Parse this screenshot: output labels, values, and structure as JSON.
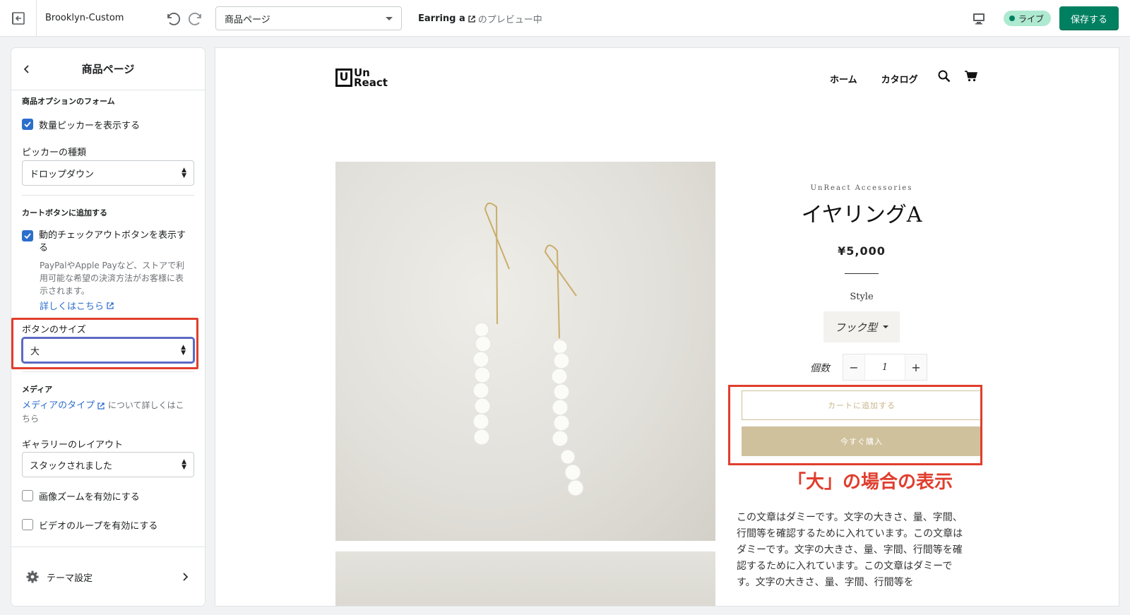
{
  "topbar": {
    "theme_name": "Brooklyn-Custom",
    "page_select": "商品ページ",
    "preview_product": "Earring a",
    "preview_suffix": "のプレビュー中",
    "live_label": "ライブ",
    "save_label": "保存する"
  },
  "sidebar": {
    "title": "商品ページ",
    "section_form": "商品オプションのフォーム",
    "show_qty_picker": "数量ピッカーを表示する",
    "picker_type_label": "ピッカーの種類",
    "picker_type_value": "ドロップダウン",
    "section_cart": "カートボタンに追加する",
    "dynamic_checkout": "動的チェックアウトボタンを表示する",
    "dynamic_help": "PayPalやApple Payなど、ストアで利用可能な希望の決済方法がお客様に表示されます。",
    "learn_more": "詳しくはこちら",
    "button_size_label": "ボタンのサイズ",
    "button_size_value": "大",
    "section_media": "メディア",
    "media_type_link": "メディアのタイプ",
    "media_type_suffix": "について詳しくはこちら",
    "gallery_layout_label": "ギャラリーのレイアウト",
    "gallery_layout_value": "スタックされました",
    "image_zoom": "画像ズームを有効にする",
    "video_loop": "ビデオのループを有効にする",
    "theme_settings": "テーマ設定"
  },
  "store": {
    "logo_box": "U",
    "logo_top": "Un",
    "logo_bottom": "React",
    "nav_home": "ホーム",
    "nav_catalog": "カタログ",
    "vendor": "UnReact Accessories",
    "product_title": "イヤリングA",
    "price": "¥5,000",
    "style_label": "Style",
    "style_value": "フック型",
    "qty_label": "個数",
    "qty_minus": "−",
    "qty_value": "1",
    "qty_plus": "+",
    "add_to_cart": "カートに追加する",
    "buy_now": "今すぐ購入",
    "annotation": "「大」の場合の表示",
    "description": "この文章はダミーです。文字の大きさ、量、字間、行間等を確認するために入れています。この文章はダミーです。文字の大きさ、量、字間、行間等を確認するために入れています。この文章はダミーです。文字の大きさ、量、字間、行間等を"
  },
  "colors": {
    "save_green": "#008060",
    "live_badge": "#aee9d1",
    "checkbox_blue": "#2c6ecb",
    "annotation_red": "#e03e2d",
    "button_gold": "#cfc19c"
  },
  "icons": {
    "exit": "exit-icon",
    "undo": "undo-icon",
    "redo": "redo-icon",
    "desktop": "desktop-icon",
    "search": "search-icon",
    "cart": "cart-icon",
    "gear": "gear-icon",
    "external_link": "external-link-icon"
  }
}
